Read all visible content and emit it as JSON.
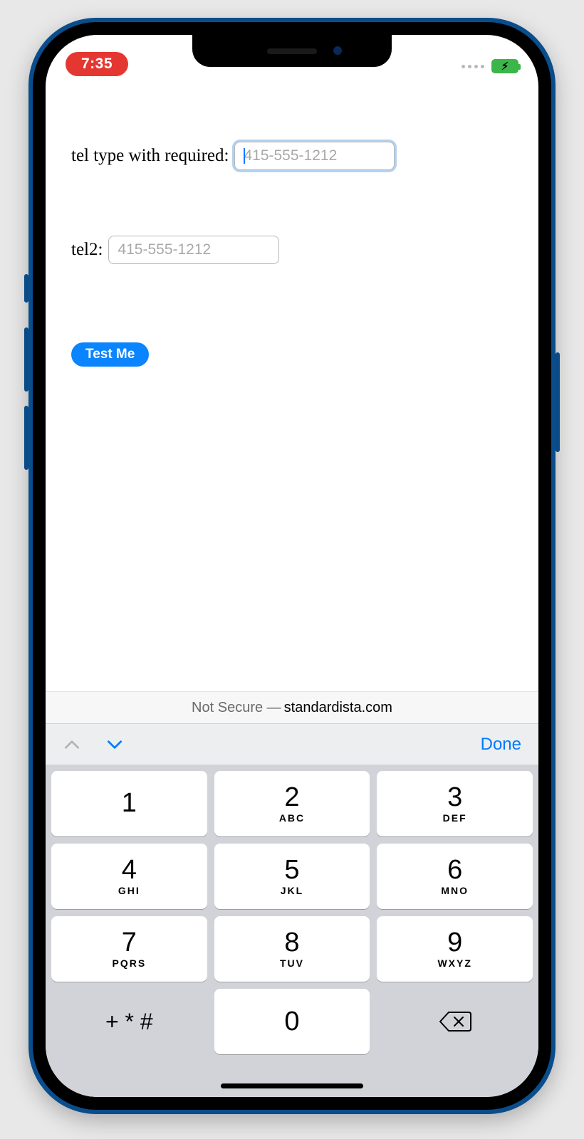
{
  "status": {
    "time": "7:35"
  },
  "form": {
    "row1": {
      "label": "tel type with required: ",
      "placeholder": "415-555-1212"
    },
    "row2": {
      "label": "tel2: ",
      "placeholder": "415-555-1212"
    },
    "button": "Test Me"
  },
  "urlbar": {
    "prefix": "Not Secure — ",
    "domain": "standardista.com"
  },
  "kbd_accessory": {
    "done": "Done"
  },
  "keypad": {
    "keys": [
      {
        "digit": "1",
        "letters": ""
      },
      {
        "digit": "2",
        "letters": "ABC"
      },
      {
        "digit": "3",
        "letters": "DEF"
      },
      {
        "digit": "4",
        "letters": "GHI"
      },
      {
        "digit": "5",
        "letters": "JKL"
      },
      {
        "digit": "6",
        "letters": "MNO"
      },
      {
        "digit": "7",
        "letters": "PQRS"
      },
      {
        "digit": "8",
        "letters": "TUV"
      },
      {
        "digit": "9",
        "letters": "WXYZ"
      }
    ],
    "symbols": "+ * #",
    "zero": "0"
  }
}
